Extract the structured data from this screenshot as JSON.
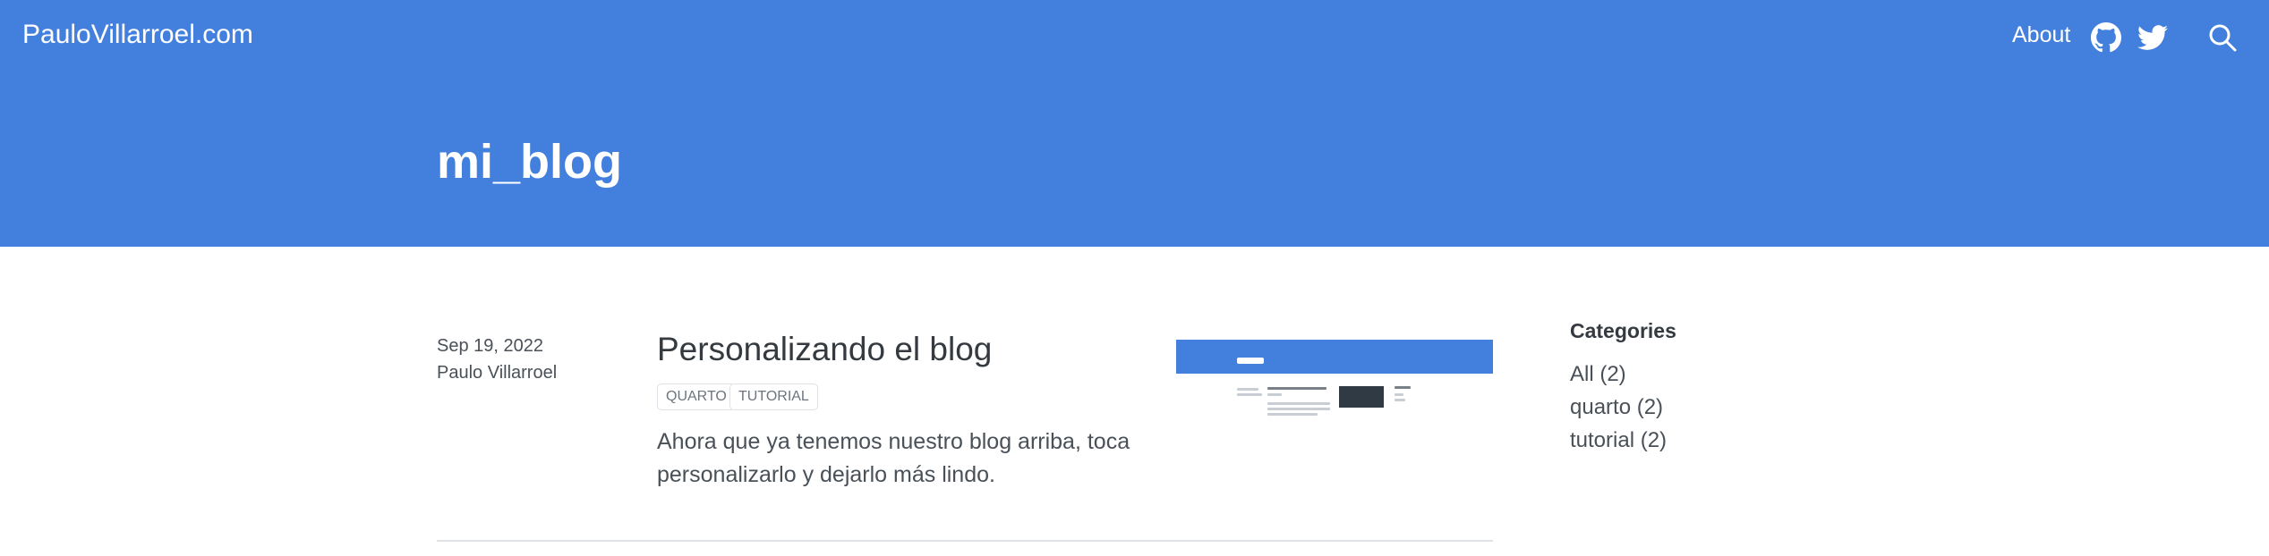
{
  "navbar": {
    "brand": "PauloVillarroel.com",
    "about_label": "About",
    "github_icon": "github-icon",
    "twitter_icon": "twitter-icon",
    "search_icon": "search-icon"
  },
  "hero": {
    "title": "mi_blog"
  },
  "posts": [
    {
      "date": "Sep 19, 2022",
      "author": "Paulo Villarroel",
      "title": "Personalizando el blog",
      "tags": [
        "QUARTO",
        "TUTORIAL"
      ],
      "description": "Ahora que ya tenemos nuestro blog arriba, toca personalizarlo y dejarlo más lindo."
    }
  ],
  "categories": {
    "heading": "Categories",
    "items": [
      "All (2)",
      "quarto (2)",
      "tutorial (2)"
    ]
  },
  "colors": {
    "brand_blue": "#4380de",
    "text": "#343a40",
    "muted": "#6c757d",
    "border": "#dee2e6"
  }
}
